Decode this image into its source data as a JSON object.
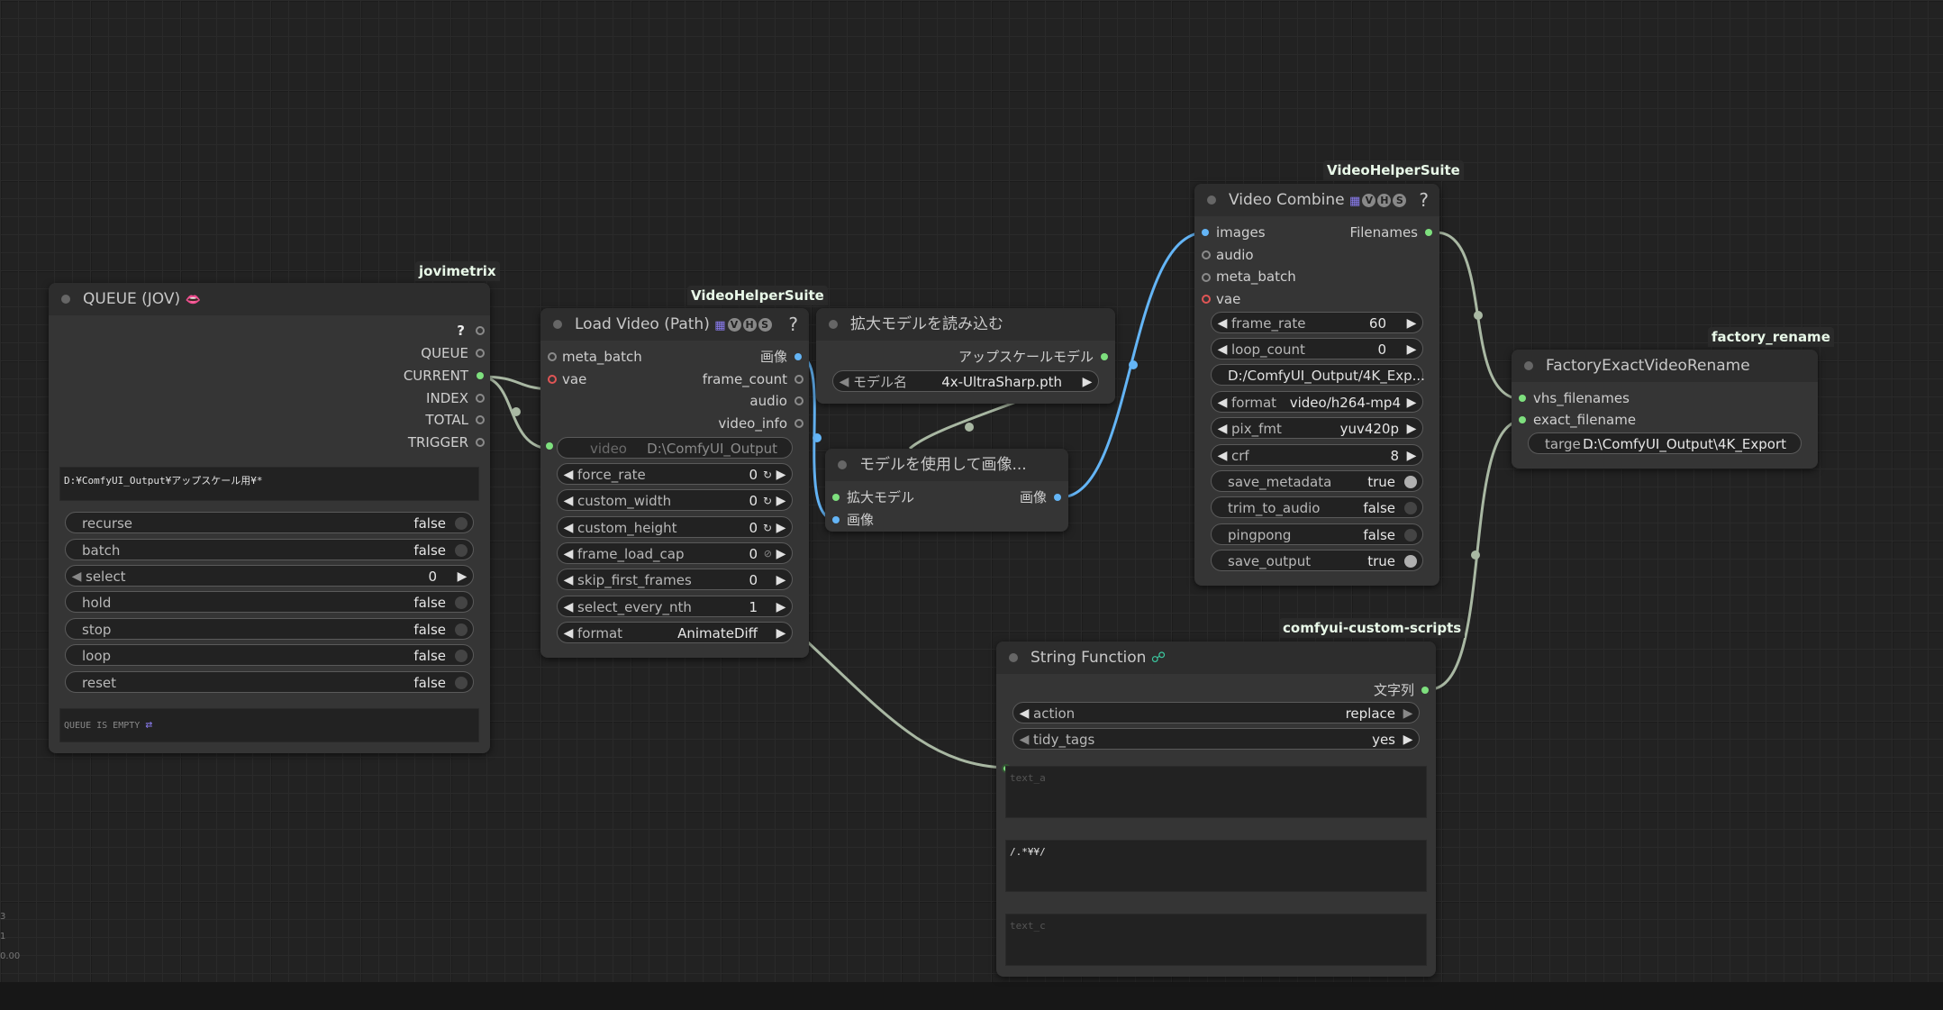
{
  "colors": {
    "wire": "#a9b8a3",
    "wire_image": "#64b5f6",
    "pin_green": "#7ee07e",
    "pin_blue": "#64b5f6",
    "pin_red": "#e05555"
  },
  "queue": {
    "group": "jovimetrix",
    "title": "QUEUE (JOV)",
    "title_icon": "mask-icon",
    "help": "?",
    "outputs": [
      "QUEUE",
      "CURRENT",
      "INDEX",
      "TOTAL",
      "TRIGGER"
    ],
    "path_text": "D:¥ComfyUI_Output¥アップスケール用¥*",
    "recurse": {
      "label": "recurse",
      "value": "false"
    },
    "batch": {
      "label": "batch",
      "value": "false"
    },
    "select": {
      "label": "select",
      "value": "0"
    },
    "hold": {
      "label": "hold",
      "value": "false"
    },
    "stop": {
      "label": "stop",
      "value": "false"
    },
    "loop": {
      "label": "loop",
      "value": "false"
    },
    "reset": {
      "label": "reset",
      "value": "false"
    },
    "status": "QUEUE IS EMPTY",
    "status_icon": "shuffle-icon"
  },
  "load_video": {
    "group": "VideoHelperSuite",
    "title": "Load Video (Path)",
    "badges": [
      "V",
      "H",
      "S"
    ],
    "help": "?",
    "inputs": [
      "meta_batch",
      "vae"
    ],
    "outputs": [
      "画像",
      "frame_count",
      "audio",
      "video_info"
    ],
    "video": {
      "label": "video",
      "value": "D:\\ComfyUI_Output"
    },
    "force_rate": {
      "label": "force_rate",
      "value": "0"
    },
    "custom_width": {
      "label": "custom_width",
      "value": "0"
    },
    "custom_height": {
      "label": "custom_height",
      "value": "0"
    },
    "frame_load_cap": {
      "label": "frame_load_cap",
      "value": "0"
    },
    "skip_first_frames": {
      "label": "skip_first_frames",
      "value": "0"
    },
    "select_every_nth": {
      "label": "select_every_nth",
      "value": "1"
    },
    "format": {
      "label": "format",
      "value": "AnimateDiff"
    }
  },
  "upscale_loader": {
    "title": "拡大モデルを読み込む",
    "output": "アップスケールモデル",
    "model": {
      "label": "モデル名",
      "value": "4x-UltraSharp.pth"
    }
  },
  "upscale_apply": {
    "title": "モデルを使用して画像...",
    "inputs": [
      "拡大モデル",
      "画像"
    ],
    "output": "画像"
  },
  "video_combine": {
    "group": "VideoHelperSuite",
    "title": "Video Combine",
    "badges": [
      "V",
      "H",
      "S"
    ],
    "help": "?",
    "inputs": [
      "images",
      "audio",
      "meta_batch",
      "vae"
    ],
    "output": "Filenames",
    "frame_rate": {
      "label": "frame_rate",
      "value": "60"
    },
    "loop_count": {
      "label": "loop_count",
      "value": "0"
    },
    "filename_prefix": "D:/ComfyUI_Output/4K_Exp...",
    "format": {
      "label": "format",
      "value": "video/h264-mp4"
    },
    "pix_fmt": {
      "label": "pix_fmt",
      "value": "yuv420p"
    },
    "crf": {
      "label": "crf",
      "value": "8"
    },
    "save_metadata": {
      "label": "save_metadata",
      "value": "true"
    },
    "trim_to_audio": {
      "label": "trim_to_audio",
      "value": "false"
    },
    "pingpong": {
      "label": "pingpong",
      "value": "false"
    },
    "save_output": {
      "label": "save_output",
      "value": "true"
    }
  },
  "factory": {
    "group": "factory_rename",
    "title": "FactoryExactVideoRename",
    "inputs": [
      "vhs_filenames",
      "exact_filename"
    ],
    "target": {
      "label": "targe ...",
      "value": "D:\\ComfyUI_Output\\4K_Export"
    }
  },
  "string_fn": {
    "group": "comfyui-custom-scripts",
    "title": "String Function",
    "output": "文字列",
    "action": {
      "label": "action",
      "value": "replace"
    },
    "tidy_tags": {
      "label": "tidy_tags",
      "value": "yes"
    },
    "text_a": "text_a",
    "text_b": "/.*¥¥/",
    "text_c": "text_c"
  }
}
